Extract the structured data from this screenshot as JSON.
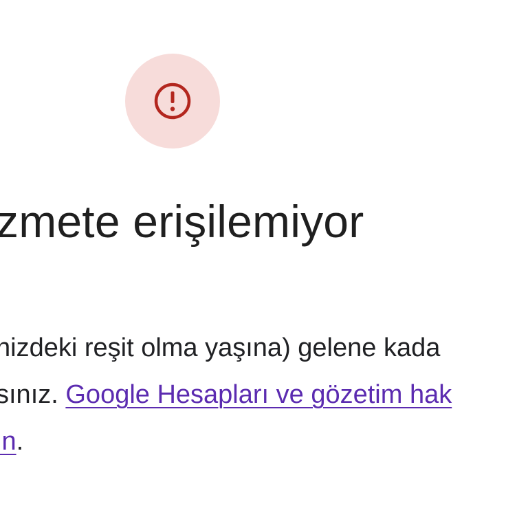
{
  "icon": {
    "name": "error-icon",
    "badge_color": "#f7dcda",
    "glyph_color": "#b3261e"
  },
  "title": "zmete erişilemiyor",
  "message": {
    "line1": "nizdeki reşit olma yaşına) gelene kada",
    "line2_prefix": "sınız. ",
    "link_part1": "Google Hesapları ve gözetim hak",
    "link_part2": "in",
    "line3_suffix": "."
  },
  "colors": {
    "text": "#1f1f1f",
    "link": "#5b2bb0"
  }
}
